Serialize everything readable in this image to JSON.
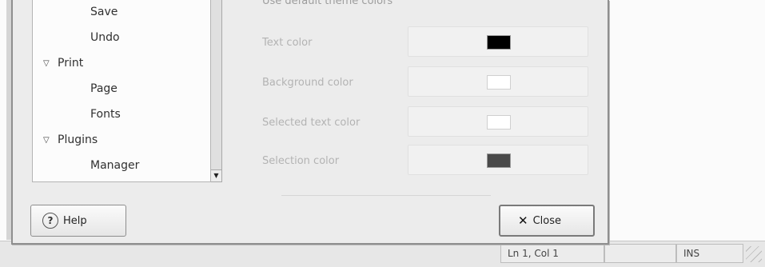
{
  "status_bar": {
    "position": "Ln 1, Col 1",
    "mode": "INS"
  },
  "tree": {
    "items": [
      {
        "label": "Save",
        "expander": false,
        "indent": 2
      },
      {
        "label": "Undo",
        "expander": false,
        "indent": 2
      },
      {
        "label": "Print",
        "expander": true,
        "indent": 1
      },
      {
        "label": "Page",
        "expander": false,
        "indent": 2
      },
      {
        "label": "Fonts",
        "expander": false,
        "indent": 2
      },
      {
        "label": "Plugins",
        "expander": true,
        "indent": 1
      },
      {
        "label": "Manager",
        "expander": false,
        "indent": 2
      }
    ]
  },
  "colors_panel": {
    "section_title": "Use default theme colors",
    "rows": [
      {
        "label": "Text color",
        "swatch": "#000000"
      },
      {
        "label": "Background color",
        "swatch": "#ffffff"
      },
      {
        "label": "Selected text color",
        "swatch": "#ffffff"
      },
      {
        "label": "Selection color",
        "swatch": "#4a4a4a"
      }
    ]
  },
  "buttons": {
    "help": "Help",
    "close": "Close"
  },
  "icons": {
    "expander": "triangle-down",
    "help": "help-icon",
    "close": "close-x-icon",
    "scroll": "scroll-down-arrow"
  }
}
